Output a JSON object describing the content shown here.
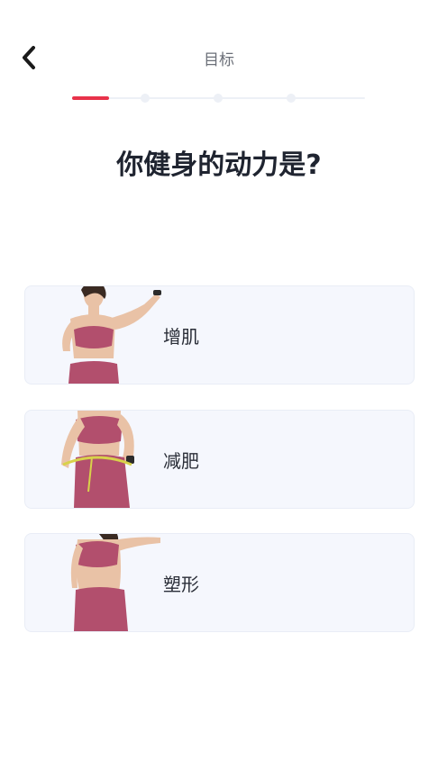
{
  "header": {
    "title": "目标",
    "back_icon": "chevron-left-icon"
  },
  "progress": {
    "steps": 5,
    "current_step": 1,
    "active_color": "#e8324a",
    "inactive_color": "#edf0f6"
  },
  "question": "你健身的动力是?",
  "options": [
    {
      "label": "增肌",
      "image": "woman-flexing-arm-photo"
    },
    {
      "label": "减肥",
      "image": "woman-measuring-waist-photo"
    },
    {
      "label": "塑形",
      "image": "woman-posing-torso-photo"
    }
  ],
  "colors": {
    "card_background": "#f5f7fd",
    "outfit": "#b24f6d",
    "skin": "#e9c2a6"
  }
}
